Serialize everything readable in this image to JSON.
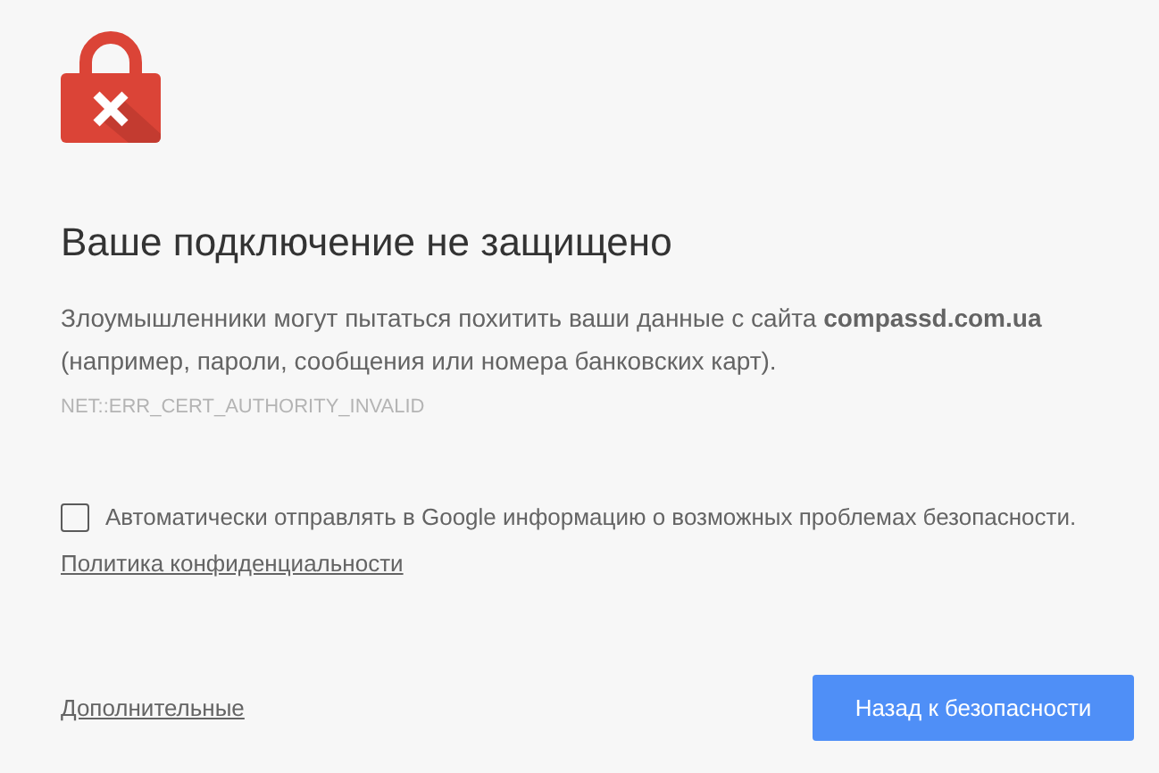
{
  "heading": "Ваше подключение не защищено",
  "message": "Злоумышленники могут пытаться похитить ваши данные с сайта **compassd.com.ua** (например, пароли, сообщения или номера банковских карт).",
  "error_code": "NET::ERR_CERT_AUTHORITY_INVALID",
  "report": {
    "label": "Автоматически отправлять в Google информацию о возможных проблемах безопасности.",
    "checked": false
  },
  "privacy_link": "Политика конфиденциальности",
  "details_link": "Дополнительные",
  "back_button": "Назад к безопасности"
}
